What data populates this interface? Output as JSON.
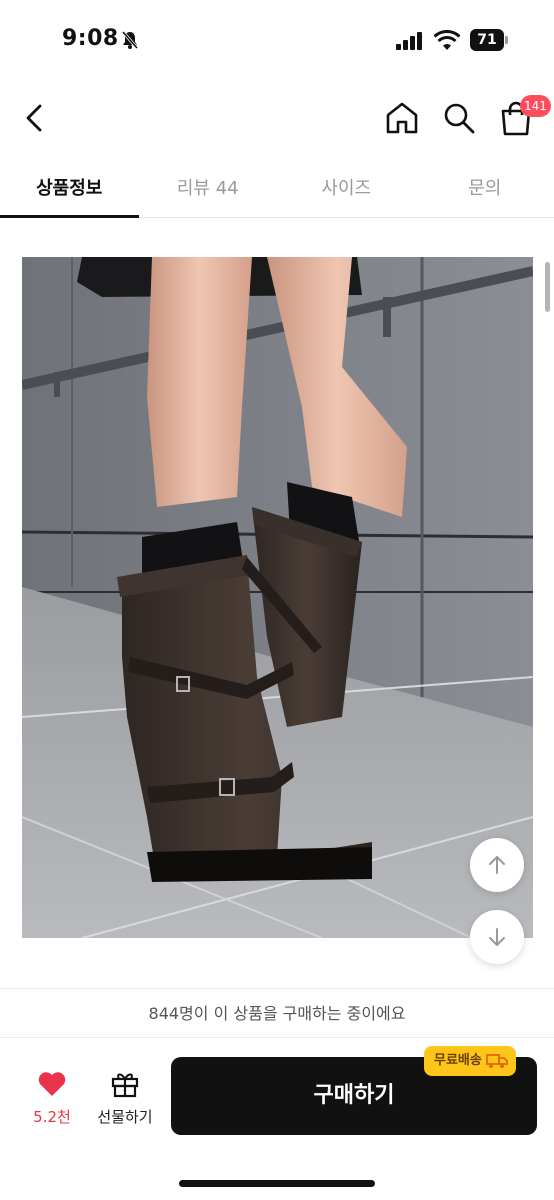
{
  "status_bar": {
    "time": "9:08",
    "battery": "71",
    "icons": [
      "bell-slash-icon",
      "signal-icon",
      "wifi-icon",
      "battery-icon"
    ]
  },
  "header": {
    "icons": [
      "back-icon",
      "home-icon",
      "search-icon",
      "cart-icon"
    ],
    "cart_count": "141",
    "badge_color": "#ff4d5e"
  },
  "tabs": [
    {
      "label": "상품정보",
      "active": true
    },
    {
      "label": "리뷰 44",
      "active": false
    },
    {
      "label": "사이즈",
      "active": false
    },
    {
      "label": "문의",
      "active": false
    }
  ],
  "product_image": {
    "icon": "product-photo-boots"
  },
  "scroll_buttons": [
    "arrow-up-icon",
    "arrow-down-icon"
  ],
  "purchase_info": "844명이 이 상품을 구매하는 중이에요",
  "bottom_bar": {
    "like_count": "5.2천",
    "like_color": "#e8334a",
    "gift_label": "선물하기",
    "buy_label": "구매하기",
    "shipping_badge": "무료배송",
    "shipping_color": "#ffc61a"
  }
}
